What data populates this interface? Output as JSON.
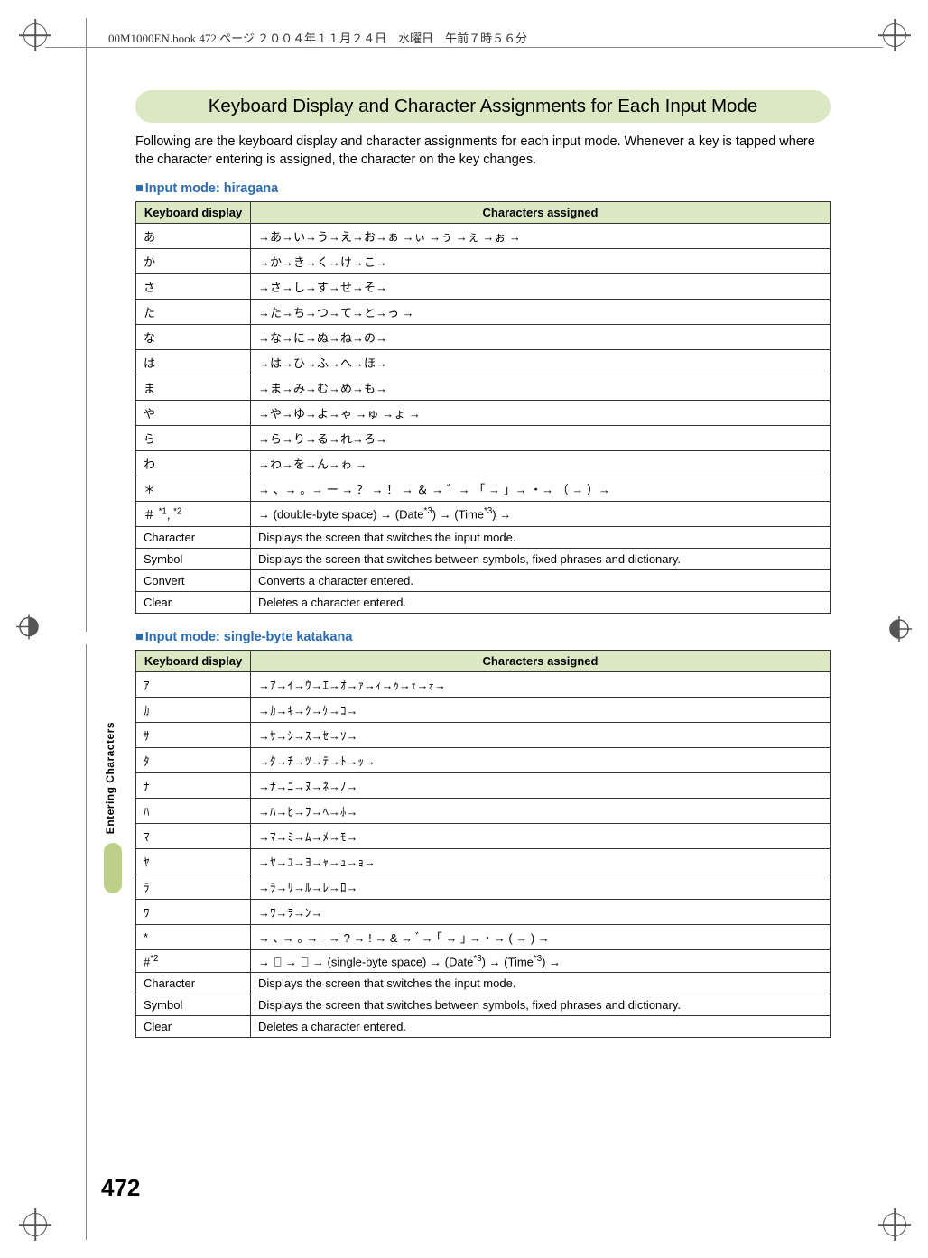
{
  "meta_header": "00M1000EN.book  472 ページ  ２００４年１１月２４日　水曜日　午前７時５６分",
  "title": "Keyboard Display and Character Assignments for Each Input Mode",
  "intro": "Following are the keyboard display and character assignments for each input mode. Whenever a key is tapped where the character entering is assigned, the character on the key changes.",
  "section1": {
    "heading": "Input mode: hiragana",
    "col_key": "Keyboard display",
    "col_chars": "Characters assigned",
    "rows": [
      {
        "k": "あ",
        "v": "→あ→い→う→え→お→ぁ →ぃ →ぅ →ぇ →ぉ →"
      },
      {
        "k": "か",
        "v": "→か→き→く→け→こ→"
      },
      {
        "k": "さ",
        "v": "→さ→し→す→せ→そ→"
      },
      {
        "k": "た",
        "v": "→た→ち→つ→て→と→っ →"
      },
      {
        "k": "な",
        "v": "→な→に→ぬ→ね→の→"
      },
      {
        "k": "は",
        "v": "→は→ひ→ふ→へ→ほ→"
      },
      {
        "k": "ま",
        "v": "→ま→み→む→め→も→"
      },
      {
        "k": "や",
        "v": "→や→ゆ→よ→ゃ →ゅ →ょ →"
      },
      {
        "k": "ら",
        "v": "→ら→り→る→れ→ろ→"
      },
      {
        "k": "わ",
        "v": "→わ→を→ん→ゎ →"
      },
      {
        "k": "＊",
        "v": "→ 、→ 。→ ー → ？ → ！ → ＆ → ゛→ 「 → 」→ ・→ （ → ）→"
      },
      {
        "k": "＃ *1, *2",
        "v": "→ (double-byte space) → (Date*3) → (Time*3) →"
      },
      {
        "k": "Character",
        "v": "Displays the screen that switches the input mode."
      },
      {
        "k": "Symbol",
        "v": "Displays the screen that switches between symbols, fixed phrases and dictionary."
      },
      {
        "k": "Convert",
        "v": "Converts a character entered."
      },
      {
        "k": "Clear",
        "v": "Deletes a character entered."
      }
    ]
  },
  "section2": {
    "heading": "Input mode: single-byte katakana",
    "col_key": "Keyboard display",
    "col_chars": "Characters assigned",
    "rows": [
      {
        "k": "ｱ",
        "v": "→ｱ→ｲ→ｳ→ｴ→ｵ→ｧ→ｨ→ｩ→ｪ→ｫ→"
      },
      {
        "k": "ｶ",
        "v": "→ｶ→ｷ→ｸ→ｹ→ｺ→"
      },
      {
        "k": "ｻ",
        "v": "→ｻ→ｼ→ｽ→ｾ→ｿ→"
      },
      {
        "k": "ﾀ",
        "v": "→ﾀ→ﾁ→ﾂ→ﾃ→ﾄ→ｯ→"
      },
      {
        "k": "ﾅ",
        "v": "→ﾅ→ﾆ→ﾇ→ﾈ→ﾉ→"
      },
      {
        "k": "ﾊ",
        "v": "→ﾊ→ﾋ→ﾌ→ﾍ→ﾎ→"
      },
      {
        "k": "ﾏ",
        "v": "→ﾏ→ﾐ→ﾑ→ﾒ→ﾓ→"
      },
      {
        "k": "ﾔ",
        "v": "→ﾔ→ﾕ→ﾖ→ｬ→ｭ→ｮ→"
      },
      {
        "k": "ﾗ",
        "v": "→ﾗ→ﾘ→ﾙ→ﾚ→ﾛ→"
      },
      {
        "k": "ﾜ",
        "v": "→ﾜ→ｦ→ﾝ→"
      },
      {
        "k": "*",
        "v": "→ ､ → ｡ → - → ? → ! → & → ﾞ→ ｢ → ｣ → ･ → ( → ) →"
      },
      {
        "k": "#*2",
        "v": "→ ﾞ → ﾟ → (single-byte space) → (Date*3) → (Time*3) →"
      },
      {
        "k": "Character",
        "v": "Displays the screen that switches the input mode."
      },
      {
        "k": "Symbol",
        "v": "Displays the screen that switches between symbols, fixed phrases and dictionary."
      },
      {
        "k": "Clear",
        "v": "Deletes a character entered."
      }
    ]
  },
  "sidebar_label": "Entering Characters",
  "page_number": "472"
}
